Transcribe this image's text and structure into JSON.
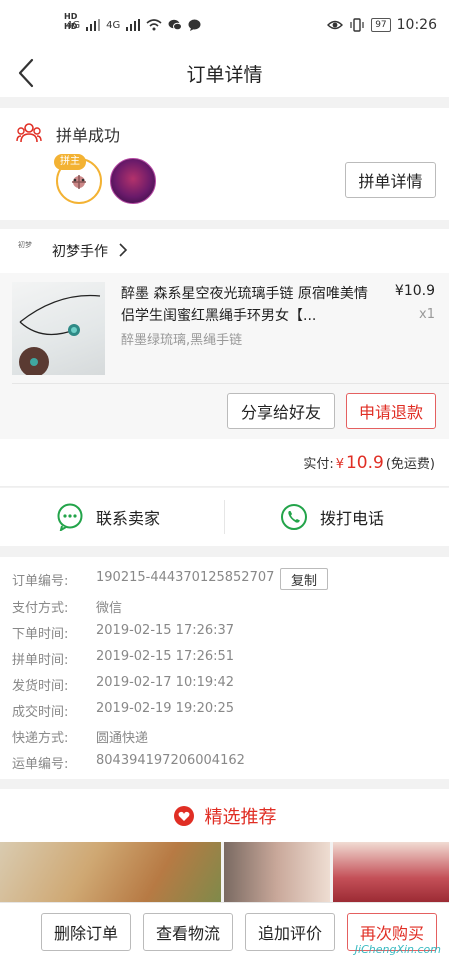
{
  "status_bar": {
    "left_indicators": [
      "4G",
      "4G"
    ],
    "battery": "97",
    "time": "10:26"
  },
  "nav": {
    "title": "订单详情"
  },
  "group": {
    "title": "拼单成功",
    "leader_badge": "拼主",
    "detail_button": "拼单详情"
  },
  "shop": {
    "name": "初梦手作",
    "logo_text": "初梦"
  },
  "product": {
    "title": "醉墨 森系星空夜光琉璃手链 原宿唯美情侣学生闺蜜红黑绳手环男女【...",
    "price": "¥10.9",
    "quantity": "x1",
    "sku": "醉墨绿琉璃,黑绳手链",
    "share_button": "分享给好友",
    "refund_button": "申请退款"
  },
  "payment": {
    "label": "实付:",
    "currency": "¥",
    "amount": "10.9",
    "note": "(免运费)"
  },
  "contact": {
    "seller_label": "联系卖家",
    "phone_label": "拨打电话"
  },
  "order_info": {
    "copy_button": "复制",
    "rows": [
      {
        "label": "订单编号:",
        "value": "190215-444370125852707"
      },
      {
        "label": "支付方式:",
        "value": "微信"
      },
      {
        "label": "下单时间:",
        "value": "2019-02-15 17:26:37"
      },
      {
        "label": "拼单时间:",
        "value": "2019-02-15 17:26:51"
      },
      {
        "label": "发货时间:",
        "value": "2019-02-17 10:19:42"
      },
      {
        "label": "成交时间:",
        "value": "2019-02-19 19:20:25"
      },
      {
        "label": "快递方式:",
        "value": "圆通快递"
      },
      {
        "label": "运单编号:",
        "value": "804394197206004162"
      }
    ]
  },
  "recommend": {
    "title": "精选推荐"
  },
  "bottom_bar": {
    "delete": "删除订单",
    "logistics": "查看物流",
    "review": "追加评价",
    "rebuy": "再次购买"
  },
  "watermark": "JiChengXin.com",
  "colors": {
    "accent": "#e02e24",
    "leader_badge": "#f3b233",
    "wechat_green": "#23a44a"
  }
}
